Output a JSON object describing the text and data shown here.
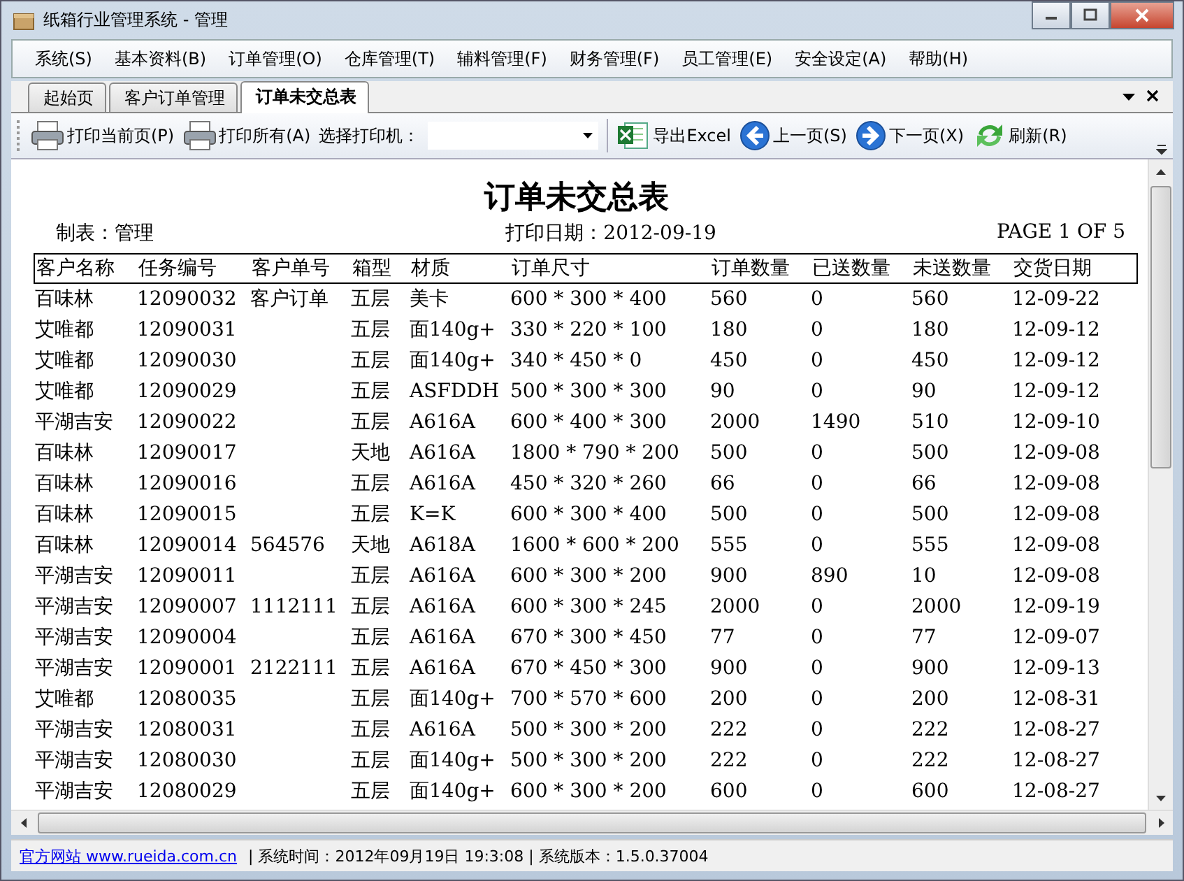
{
  "window": {
    "title": "纸箱行业管理系统 - 管理"
  },
  "menu": [
    "系统(S)",
    "基本资料(B)",
    "订单管理(O)",
    "仓库管理(T)",
    "辅料管理(F)",
    "财务管理(F)",
    "员工管理(E)",
    "安全设定(A)",
    "帮助(H)"
  ],
  "tabs": [
    {
      "label": "起始页",
      "selected": false
    },
    {
      "label": "客户订单管理",
      "selected": false
    },
    {
      "label": "订单未交总表",
      "selected": true
    }
  ],
  "toolbar": [
    {
      "kind": "printer",
      "label": "打印当前页(P)"
    },
    {
      "kind": "printer",
      "label": "打印所有(A)"
    },
    {
      "kind": "label",
      "label": "选择打印机："
    },
    {
      "kind": "dropdown"
    },
    {
      "kind": "excel",
      "label": "导出Excel"
    },
    {
      "kind": "prev",
      "label": "上一页(S)"
    },
    {
      "kind": "next",
      "label": "下一页(X)"
    },
    {
      "kind": "refresh",
      "label": "刷新(R)"
    }
  ],
  "report": {
    "title": "订单未交总表",
    "maker": "制表：管理",
    "print_date": "打印日期：2012-09-19",
    "page": "PAGE 1 OF 5",
    "columns": [
      "客户名称",
      "任务编号",
      "客户单号",
      "箱型",
      "材质",
      "订单尺寸",
      "订单数量",
      "已送数量",
      "未送数量",
      "交货日期"
    ],
    "rows": [
      [
        "百味林",
        "12090032",
        "客户订单",
        "五层",
        "美卡",
        "600 * 300 * 400",
        "560",
        "0",
        "560",
        "12-09-22"
      ],
      [
        "艾唯都",
        "12090031",
        "",
        "五层",
        "面140g+",
        "330 * 220 * 100",
        "180",
        "0",
        "180",
        "12-09-12"
      ],
      [
        "艾唯都",
        "12090030",
        "",
        "五层",
        "面140g+",
        "340 * 450 * 0",
        "450",
        "0",
        "450",
        "12-09-12"
      ],
      [
        "艾唯都",
        "12090029",
        "",
        "五层",
        "ASFDDH",
        "500 * 300 * 300",
        "90",
        "0",
        "90",
        "12-09-12"
      ],
      [
        "平湖吉安",
        "12090022",
        "",
        "五层",
        "A616A",
        "600 * 400 * 300",
        "2000",
        "1490",
        "510",
        "12-09-10"
      ],
      [
        "百味林",
        "12090017",
        "",
        "天地",
        "A616A",
        "1800 * 790 * 200",
        "500",
        "0",
        "500",
        "12-09-08"
      ],
      [
        "百味林",
        "12090016",
        "",
        "五层",
        "A616A",
        "450 * 320 * 260",
        "66",
        "0",
        "66",
        "12-09-08"
      ],
      [
        "百味林",
        "12090015",
        "",
        "五层",
        "K=K",
        "600 * 300 * 400",
        "500",
        "0",
        "500",
        "12-09-08"
      ],
      [
        "百味林",
        "12090014",
        "564576",
        "天地",
        "A618A",
        "1600 * 600 * 200",
        "555",
        "0",
        "555",
        "12-09-08"
      ],
      [
        "平湖吉安",
        "12090011",
        "",
        "五层",
        "A616A",
        "600 * 300 * 200",
        "900",
        "890",
        "10",
        "12-09-08"
      ],
      [
        "平湖吉安",
        "12090007",
        "1112111",
        "五层",
        "A616A",
        "600 * 300 * 245",
        "2000",
        "0",
        "2000",
        "12-09-19"
      ],
      [
        "平湖吉安",
        "12090004",
        "",
        "五层",
        "A616A",
        "670 * 300 * 450",
        "77",
        "0",
        "77",
        "12-09-07"
      ],
      [
        "平湖吉安",
        "12090001",
        "2122111",
        "五层",
        "A616A",
        "670 * 450 * 300",
        "900",
        "0",
        "900",
        "12-09-13"
      ],
      [
        "艾唯都",
        "12080035",
        "",
        "五层",
        "面140g+",
        "700 * 570 * 600",
        "200",
        "0",
        "200",
        "12-08-31"
      ],
      [
        "平湖吉安",
        "12080031",
        "",
        "五层",
        "A616A",
        "500 * 300 * 200",
        "222",
        "0",
        "222",
        "12-08-27"
      ],
      [
        "平湖吉安",
        "12080030",
        "",
        "五层",
        "面140g+",
        "500 * 300 * 200",
        "222",
        "0",
        "222",
        "12-08-27"
      ],
      [
        "平湖吉安",
        "12080029",
        "",
        "五层",
        "面140g+",
        "600 * 300 * 200",
        "600",
        "0",
        "600",
        "12-08-27"
      ]
    ]
  },
  "status_bar": {
    "link": "官方网站 www.rueida.com.cn",
    "text": "| 系统时间：2012年09月19日 19:3:08 | 系统版本：1.5.0.37004"
  }
}
